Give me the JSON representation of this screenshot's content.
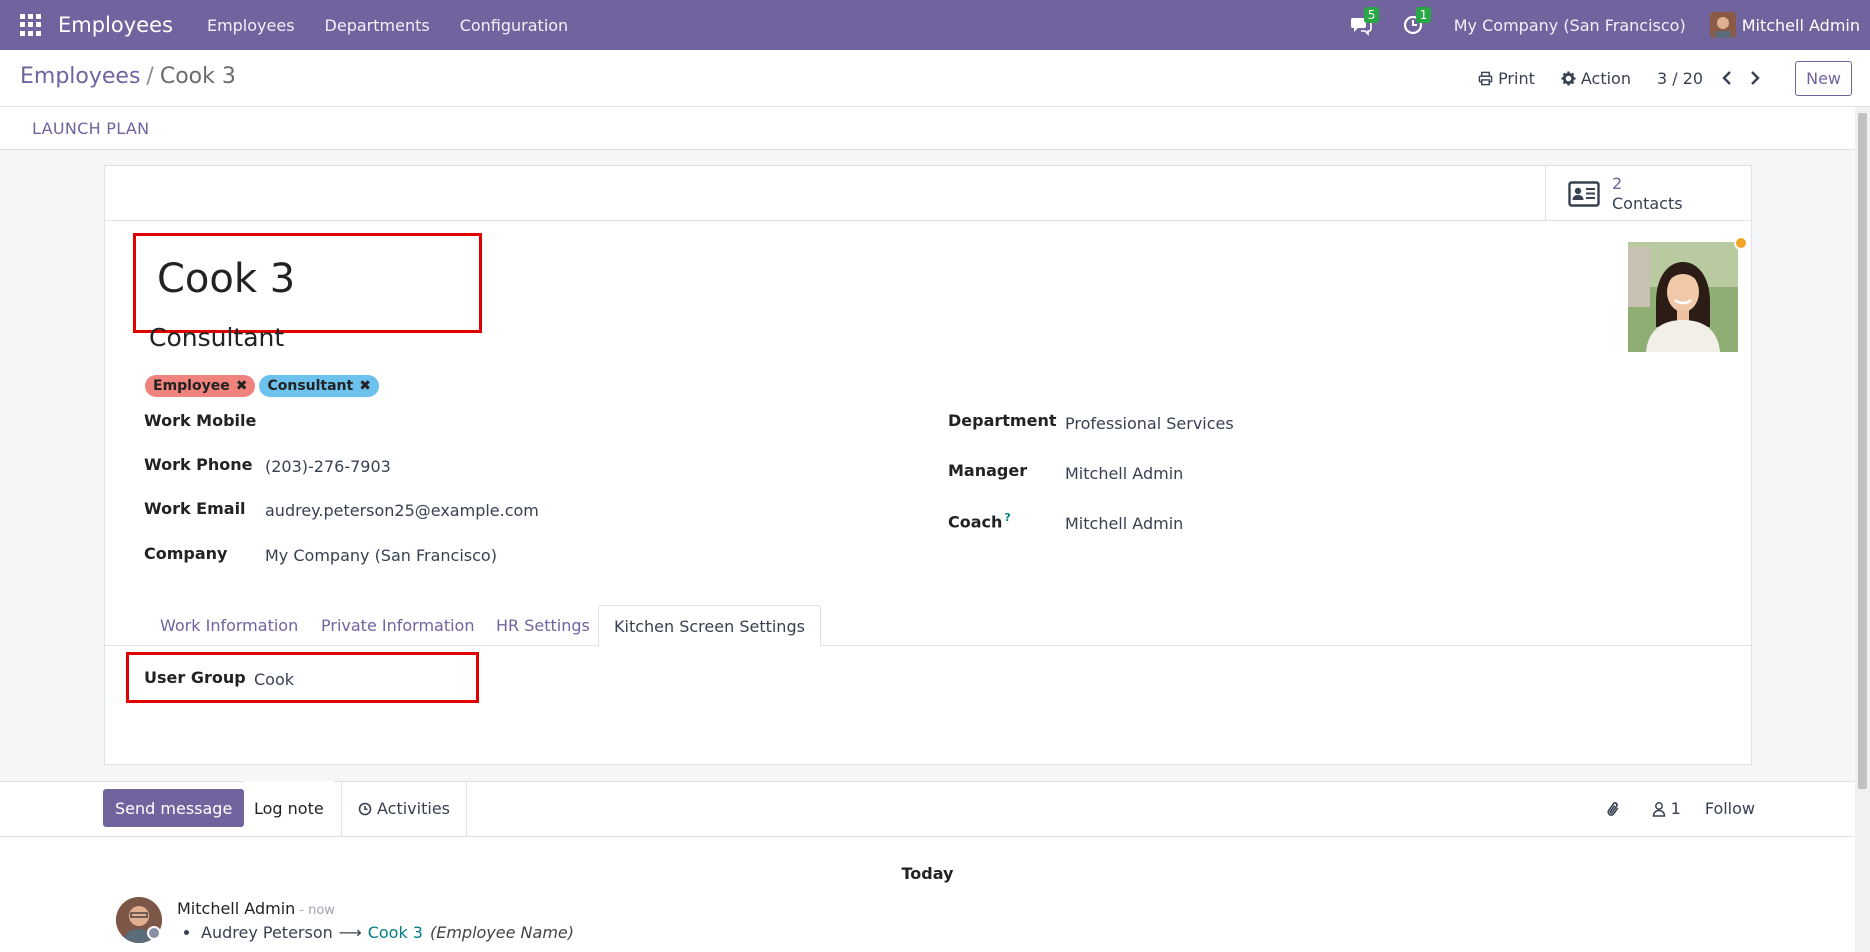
{
  "navbar": {
    "app_name": "Employees",
    "menus": [
      "Employees",
      "Departments",
      "Configuration"
    ],
    "messages_count": "5",
    "activities_count": "1",
    "company": "My Company (San Francisco)",
    "user": "Mitchell Admin"
  },
  "control": {
    "breadcrumb_parent": "Employees",
    "breadcrumb_sep": "/",
    "breadcrumb_current": "Cook 3",
    "print_label": "Print",
    "action_label": "Action",
    "pager": "3 / 20",
    "new_label": "New"
  },
  "statusbar": {
    "launch_plan": "LAUNCH PLAN"
  },
  "smart_button": {
    "count": "2",
    "label": "Contacts"
  },
  "employee": {
    "name": "Cook 3",
    "job_title": "Consultant",
    "tags": [
      "Employee",
      "Consultant"
    ]
  },
  "fields_left": [
    {
      "label": "Work Mobile",
      "value": ""
    },
    {
      "label": "Work Phone",
      "value": "(203)-276-7903"
    },
    {
      "label": "Work Email",
      "value": "audrey.peterson25@example.com"
    },
    {
      "label": "Company",
      "value": "My Company (San Francisco)"
    }
  ],
  "fields_right": [
    {
      "label": "Department",
      "value": "Professional Services"
    },
    {
      "label": "Manager",
      "value": "Mitchell Admin"
    },
    {
      "label": "Coach",
      "value": "Mitchell Admin",
      "help": "?"
    }
  ],
  "tabs": [
    "Work Information",
    "Private Information",
    "HR Settings",
    "Kitchen Screen Settings"
  ],
  "kitchen": {
    "user_group_label": "User Group",
    "user_group_value": "Cook"
  },
  "chatter": {
    "send_message": "Send message",
    "log_note": "Log note",
    "activities": "Activities",
    "followers_count": "1",
    "follow": "Follow",
    "today": "Today",
    "message": {
      "author": "Mitchell Admin",
      "time": "- now",
      "old_value": "Audrey Peterson",
      "new_value": "Cook 3",
      "field": "(Employee Name)"
    }
  },
  "colors": {
    "brand": "#71639e",
    "highlight_box": "#e00000",
    "tag_employee": "#f1837f",
    "tag_consultant": "#6cc1ed",
    "link": "#017e84"
  }
}
